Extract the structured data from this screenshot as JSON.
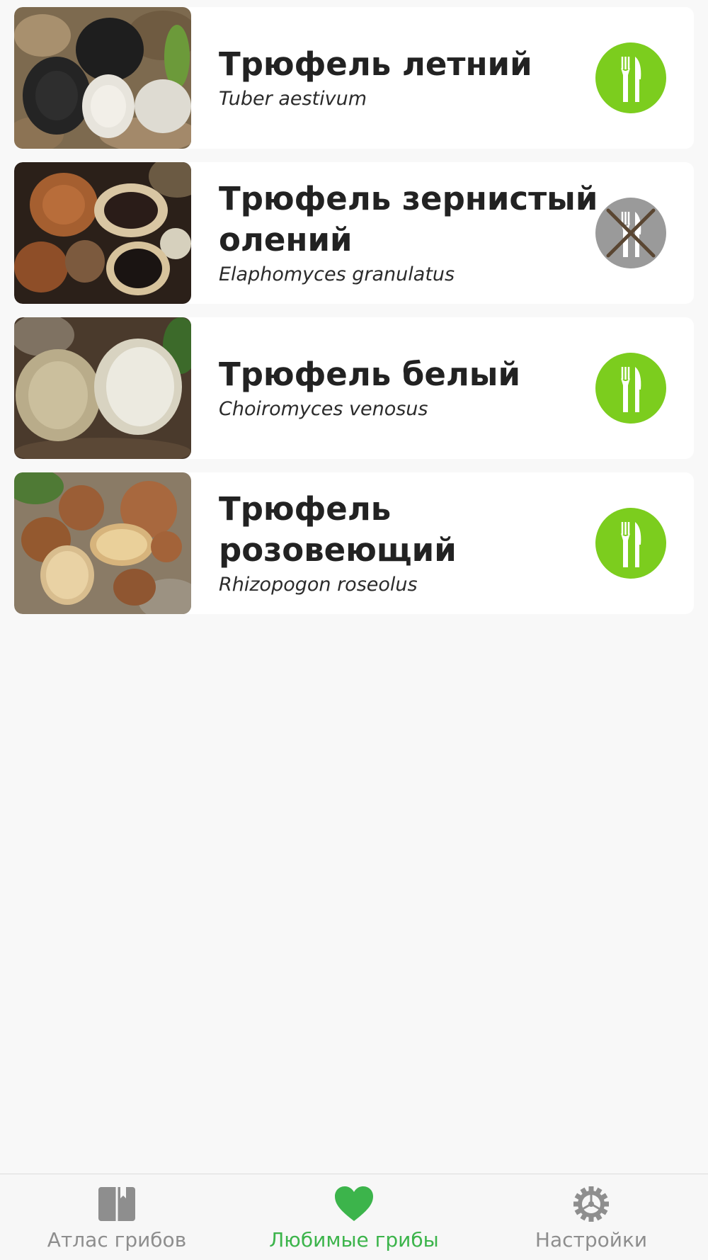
{
  "mushrooms": [
    {
      "name": "Трюфель летний",
      "latin": "Tuber aestivum",
      "edible": true,
      "photo_icon": "black-truffle-photo"
    },
    {
      "name": "Трюфель зернистый олений",
      "latin": "Elaphomyces granulatus",
      "edible": false,
      "photo_icon": "deer-truffle-photo"
    },
    {
      "name": "Трюфель белый",
      "latin": "Choiromyces venosus",
      "edible": true,
      "photo_icon": "white-truffle-photo"
    },
    {
      "name": "Трюфель розовеющий",
      "latin": "Rhizopogon roseolus",
      "edible": true,
      "photo_icon": "blushing-truffle-photo"
    }
  ],
  "badges": {
    "edible_icon": "fork-knife-icon",
    "inedible_icon": "crossed-fork-knife-icon",
    "edible_color": "#7ccd1e",
    "inedible_color": "#9a9a9a"
  },
  "tabbar": {
    "active_color": "#3cb44b",
    "inactive_color": "#8e8e8e",
    "tabs": [
      {
        "label": "Атлас грибов",
        "icon": "book-icon",
        "active": false
      },
      {
        "label": "Любимые грибы",
        "icon": "heart-icon",
        "active": true
      },
      {
        "label": "Настройки",
        "icon": "gear-icon",
        "active": false
      }
    ]
  }
}
